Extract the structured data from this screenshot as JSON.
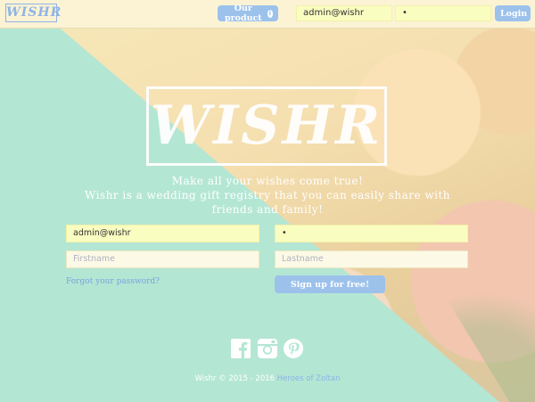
{
  "nav": {
    "logo": "WISHR",
    "product_button": "Our product",
    "email_value": "admin@wishr",
    "password_value": "•",
    "login_button": "Login"
  },
  "hero": {
    "logo": "WISHR",
    "tagline_line1": "Make all your wishes come true!",
    "tagline_line2": "Wishr is a wedding gift registry that you can easily share with friends and family!"
  },
  "signup": {
    "email_value": "admin@wishr",
    "password_value": "•",
    "firstname_placeholder": "Firstname",
    "lastname_placeholder": "Lastname",
    "forgot_link": "Forgot your password?",
    "signup_button": "Sign up for free!"
  },
  "social": [
    "facebook-icon",
    "instagram-icon",
    "pinterest-icon"
  ],
  "footer": {
    "copyright": "Wishr © 2015 - 2016",
    "team_link": "Heroes of Zoltan"
  },
  "colors": {
    "accent": "#9cc2ec",
    "mint": "#b4e6d4",
    "input_fill": "#fafdc0"
  }
}
